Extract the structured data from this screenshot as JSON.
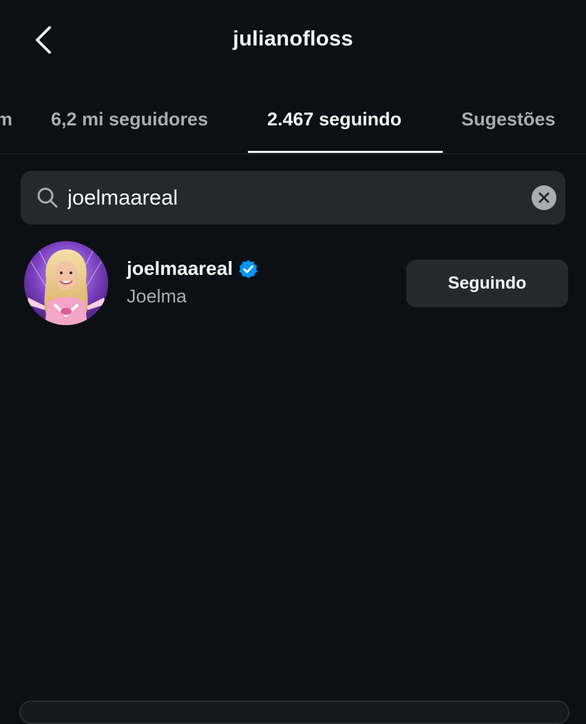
{
  "header": {
    "title": "julianofloss",
    "back_icon": "chevron-left-icon"
  },
  "tabs": [
    {
      "label": "m",
      "active": false
    },
    {
      "label": "6,2 mi seguidores",
      "active": false
    },
    {
      "label": "2.467 seguindo",
      "active": true
    },
    {
      "label": "Sugestões",
      "active": false
    }
  ],
  "search": {
    "value": "joelmaareal",
    "search_icon": "search-icon",
    "clear_icon": "close-icon"
  },
  "results": [
    {
      "username": "joelmaareal",
      "verified": true,
      "full_name": "Joelma",
      "button_label": "Seguindo"
    }
  ],
  "colors": {
    "background": "#0c1014",
    "surface": "#25292e",
    "text_primary": "#f5f5f5",
    "text_secondary": "#a8adb3",
    "verified_blue": "#0095f6"
  }
}
